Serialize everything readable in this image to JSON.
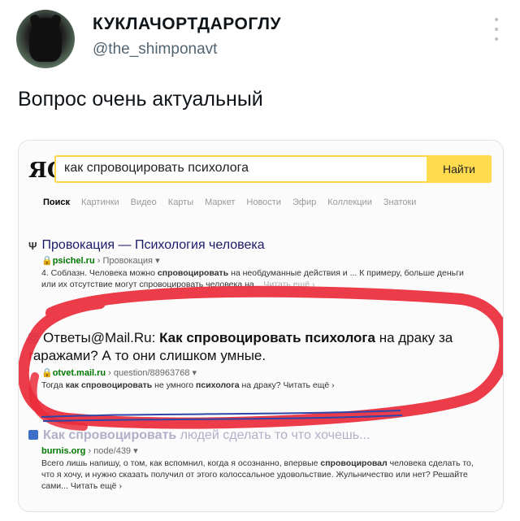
{
  "tweet": {
    "display_name": "КУКЛАЧОРТДАРОГЛУ",
    "handle": "@the_shimponavt",
    "text": "Вопрос очень актуальный"
  },
  "search": {
    "logo": "ЯС",
    "query": "как спровоцировать психолога",
    "button_label": "Найти",
    "tabs": [
      "Поиск",
      "Картинки",
      "Видео",
      "Карты",
      "Маркет",
      "Новости",
      "Эфир",
      "Коллекции",
      "Знатоки"
    ]
  },
  "results": [
    {
      "title": "Провокация — Психология человека",
      "domain": "psichel.ru",
      "path": "› Провокация ▾",
      "snippet_pre": "4. Соблазн. Человека можно ",
      "snippet_bold": "спровоцировать",
      "snippet_post": " на необдуманные действия и ... К примеру, больше деньги или их отсутствие могут спровоцировать человека на...",
      "more": "Читать ещё ›"
    },
    {
      "title_pre": "Ответы@Mail.Ru: ",
      "title_bold": "Как спровоцировать психолога",
      "title_post": " на драку за гаражами? А то они слишком умные.",
      "domain": "otvet.mail.ru",
      "path": "› question/88963768 ▾",
      "snippet_pre": "Тогда ",
      "snippet_bold1": "как спровоцировать",
      "snippet_mid": " не умного ",
      "snippet_bold2": "психолога",
      "snippet_post": " на драку? Читать ещё ›"
    },
    {
      "title_bold": "Как спровоцировать",
      "title_post": " людей сделать то что хочешь...",
      "domain": "burnis.org",
      "path": "› node/439 ▾",
      "snippet_pre": "Всего лишь напишу, о том, как вспомнил, когда я осознанно, впервые ",
      "snippet_bold": "спровоцировал",
      "snippet_post": " человека сделать то, что я хочу, и нужно сказать получил от этого колоссальное удовольствие. Жульничество или нет? Решайте сами... Читать ещё ›"
    }
  ],
  "colors": {
    "accent_yellow": "#ffdb4d",
    "marker_red": "#ea2b3a",
    "url_green": "#007700",
    "underline_blue": "#2f45a8"
  }
}
